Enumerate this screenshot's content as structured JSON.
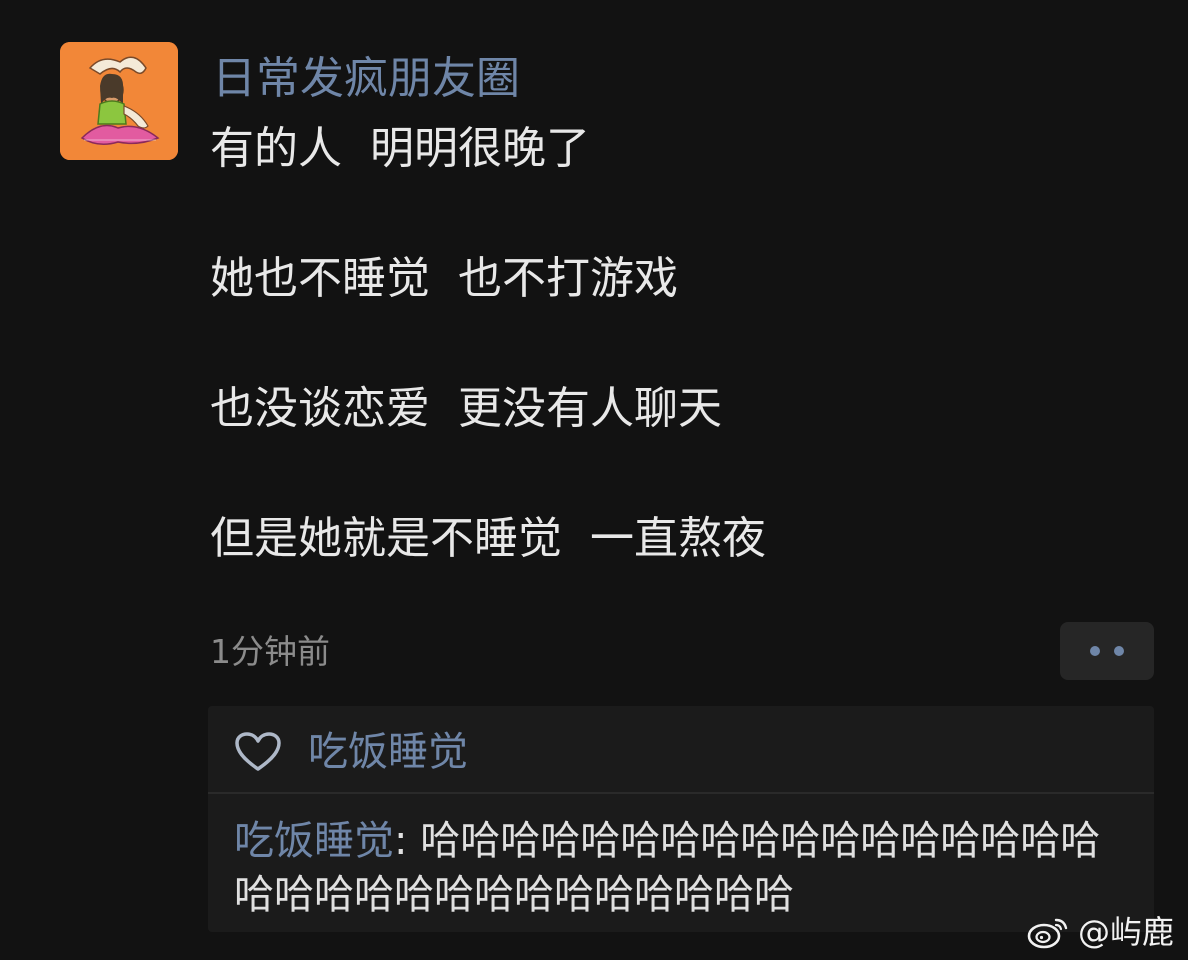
{
  "post": {
    "author_name": "日常发疯朋友圈",
    "avatar_icon": "yoga-woman-avatar",
    "lines": [
      "有的人  明明很晚了",
      "她也不睡觉  也不打游戏",
      "也没谈恋爱  更没有人聊天",
      "但是她就是不睡觉  一直熬夜"
    ],
    "timestamp": "1分钟前",
    "more_icon": "more-dots-icon"
  },
  "interactions": {
    "like_icon": "heart-icon",
    "likes": "吃饭睡觉",
    "comments": [
      {
        "author": "吃饭睡觉",
        "separator": ": ",
        "text": "哈哈哈哈哈哈哈哈哈哈哈哈哈哈哈哈哈哈哈哈哈哈哈哈哈哈哈哈哈哈哈"
      }
    ]
  },
  "watermark": {
    "icon": "weibo-icon",
    "text": "@屿鹿"
  },
  "colors": {
    "background": "#121212",
    "name_blue": "#6f86a8",
    "panel": "#1b1b1b",
    "avatar_orange": "#f07a2f"
  }
}
